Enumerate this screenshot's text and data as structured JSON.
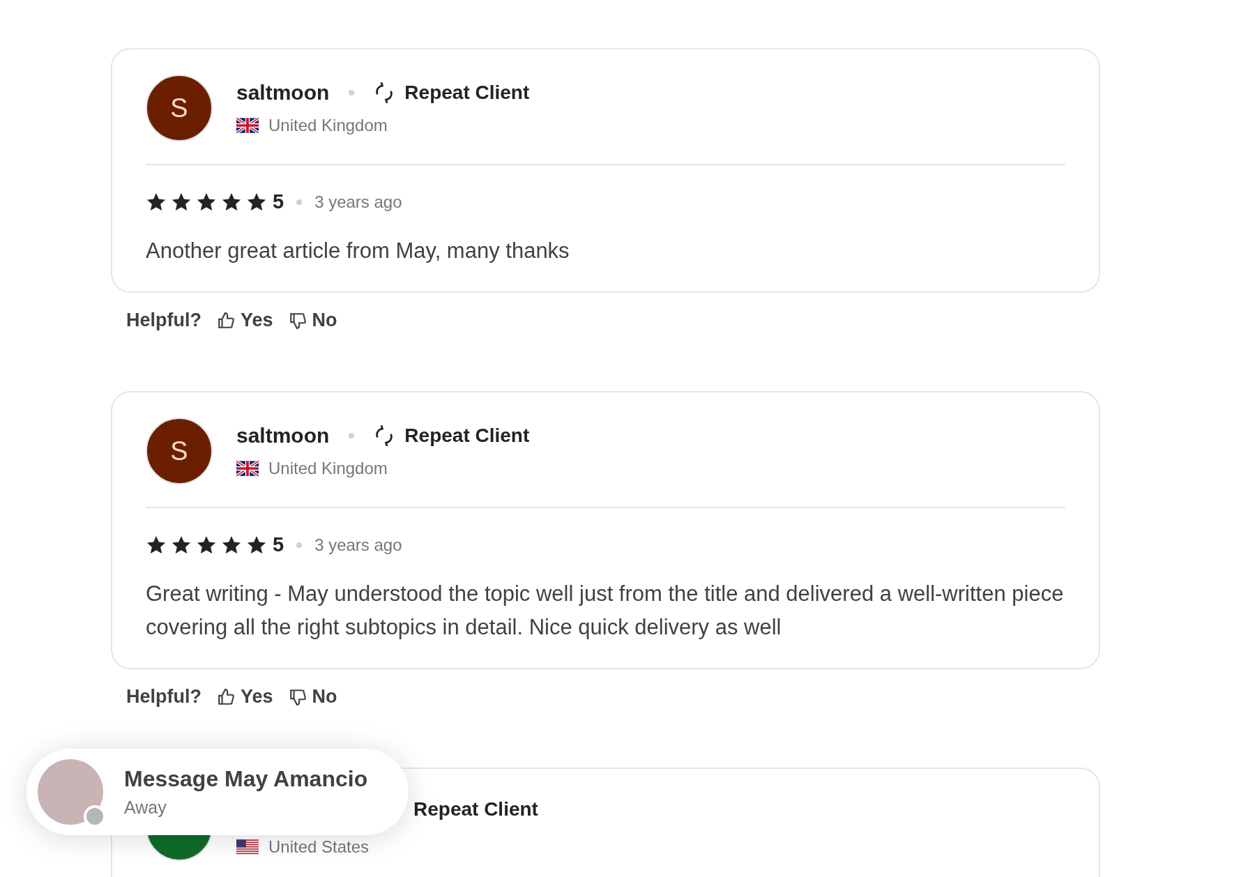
{
  "reviews": [
    {
      "avatar_letter": "S",
      "color": "#6b1f00",
      "name": "saltmoon",
      "badge": "Repeat Client",
      "country": {
        "kind": "uk",
        "name": "United Kingdom"
      },
      "stars": 5,
      "rating": "5",
      "time": "3 years ago",
      "text": "Another great article from May, many thanks",
      "helpful": {
        "label": "Helpful?",
        "yes": "Yes",
        "no": "No"
      }
    },
    {
      "avatar_letter": "S",
      "color": "#6b1f00",
      "name": "saltmoon",
      "badge": "Repeat Client",
      "country": {
        "kind": "uk",
        "name": "United Kingdom"
      },
      "stars": 5,
      "rating": "5",
      "time": "3 years ago",
      "text": "Great writing - May understood the topic well just from the title and delivered a well-written piece covering all the right subtopics in detail. Nice quick delivery as well",
      "helpful": {
        "label": "Helpful?",
        "yes": "Yes",
        "no": "No"
      }
    },
    {
      "color": "#0f6b2a",
      "badge": "Repeat Client",
      "country": {
        "kind": "us",
        "name": "United States"
      }
    }
  ],
  "chat_popup": {
    "title": "Message May Amancio",
    "status": "Away"
  }
}
